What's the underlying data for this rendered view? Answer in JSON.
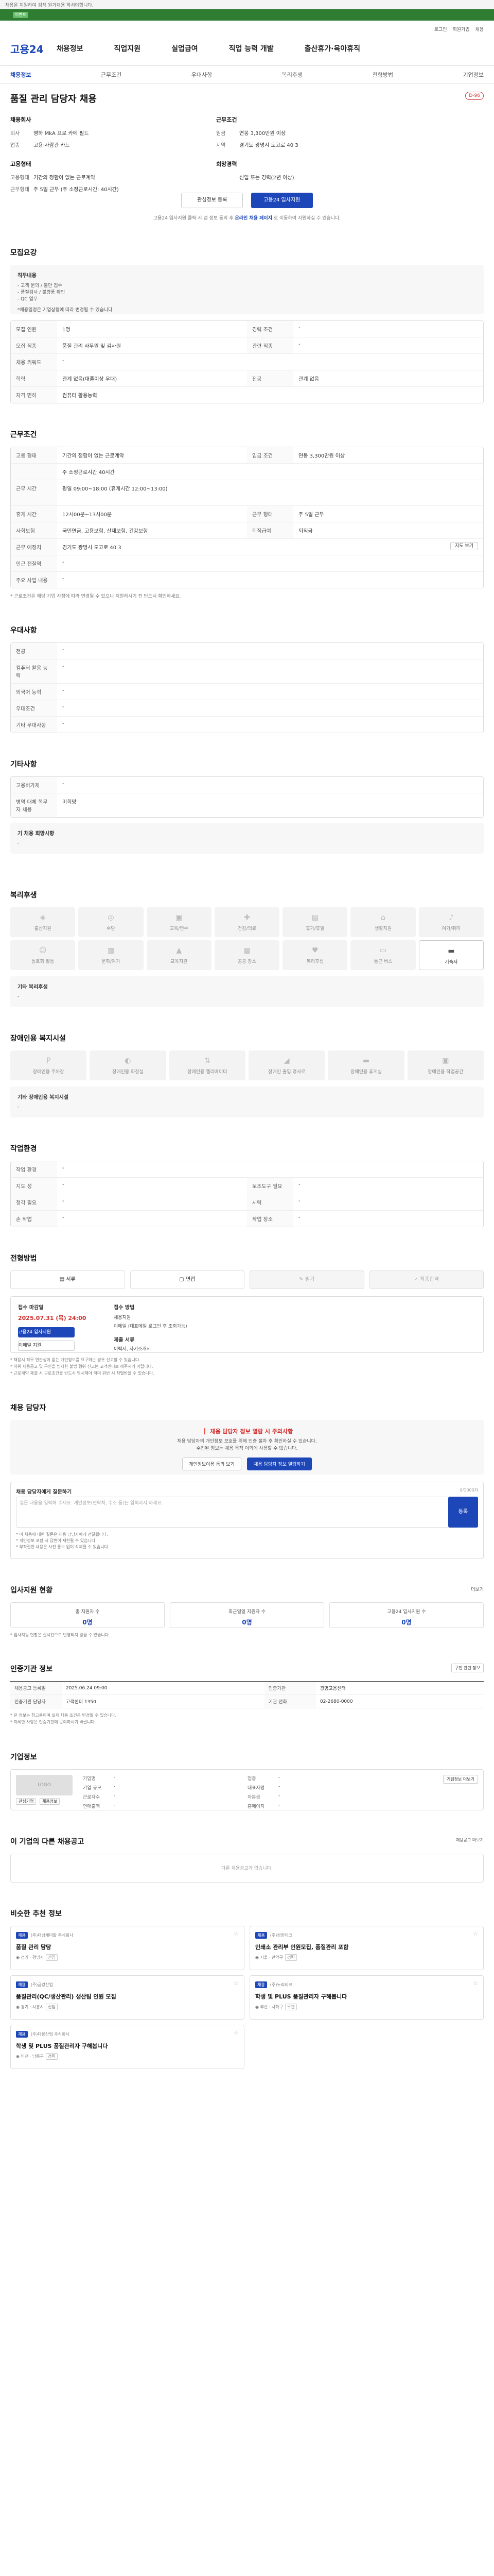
{
  "top": {
    "notice": "채용을 지원하여 검색 원가채용 하셔야합니다.",
    "promo_label": "이벤트"
  },
  "header": {
    "util": [
      "로그인",
      "회원가입",
      "채용"
    ],
    "logo": "고용24",
    "gnb": [
      "채용정보",
      "직업지원",
      "실업급여",
      "직업 능력 개발",
      "출산휴가·육아휴직"
    ]
  },
  "lnb": [
    "채용정보",
    "근무조건",
    "우대사항",
    "복리후생",
    "전형방법",
    "기업정보"
  ],
  "job": {
    "title": "품질 관리 담당자 채용",
    "dday": "D-96",
    "left_label": "채용회사",
    "left_rows": [
      {
        "k": "회사",
        "v": "영하 MkA 프로 카메 필드"
      },
      {
        "k": "업종",
        "v": "고용·사람관 카드"
      }
    ],
    "left2_label": "고용형태",
    "left2_rows": [
      {
        "k": "고용형태",
        "v": "기간의 정함이 없는 근로계약"
      },
      {
        "k": "근무형태",
        "v": "주 5일 근무 (주 소정근로시간: 40시간)"
      }
    ],
    "right_label": "근무조건",
    "right_rows": [
      {
        "k": "임금",
        "v": "연봉 3,300만원 이상"
      },
      {
        "k": "지역",
        "v": "경기도 광명시 도고로 40 3"
      }
    ],
    "right2_label": "희망경력",
    "right2_rows": [
      {
        "k": "",
        "v": "신입 또는 경력(2년 이상)"
      }
    ],
    "btn_save": "관심정보 등록",
    "btn_apply": "고용24 입사지원",
    "btn_note_a": "고용24 입사지원 클릭 시 앱 정보 동의 후",
    "btn_note_b": "온라인 채용 페이지",
    "btn_note_c": "로 이동하여 지원하실 수 있습니다."
  },
  "recruit": {
    "title": "모집요강",
    "intro_label": "직무내용",
    "intro_lines": [
      "- 고객 문의 / 불만 접수",
      "- 품질검사 / 불량품 확인",
      "- QC 업무",
      "",
      "*채용일정은 기업상황에 따라 변경될 수 있습니다"
    ],
    "rows": [
      [
        {
          "k": "모집 인원",
          "v": "1명"
        },
        {
          "k": "경력 조건",
          "v": "-"
        }
      ],
      [
        {
          "k": "모집 직종",
          "v": "품질 관리 사무원 및 검사원"
        },
        {
          "k": "관련 직종",
          "v": "-"
        }
      ],
      [
        {
          "k": "채용 키워드",
          "v": "-"
        },
        {
          "k": "",
          "v": ""
        }
      ],
      [
        {
          "k": "학력",
          "v": "관계 없음(대졸이상 우대)"
        },
        {
          "k": "전공",
          "v": "관계 없음"
        }
      ],
      [
        {
          "k": "자격 면허",
          "v": "컴퓨터 활용능력"
        },
        {
          "k": "",
          "v": ""
        }
      ]
    ]
  },
  "work": {
    "title": "근무조건",
    "rows": [
      [
        {
          "k": "고용 형태",
          "v": "기간의 정함이 없는 근로계약"
        },
        {
          "k": "임금 조건",
          "v": "연봉 3,300만원 이상"
        }
      ],
      [
        {
          "k": "",
          "v": "주 소정근로시간 40시간"
        },
        {
          "k": "",
          "v": ""
        }
      ],
      [
        {
          "k": "근무 시간",
          "v": "평일 09:00~18:00 (휴게시간 12:00~13:00)"
        },
        {
          "k": "",
          "v": ""
        }
      ],
      [
        {
          "k": "휴게 시간",
          "v": "12시00분~13시00분"
        },
        {
          "k": "근무 형태",
          "v": "주 5일 근무"
        }
      ],
      [
        {
          "k": "사회보험",
          "v": "국민연금, 고용보험, 산재보험, 건강보험"
        },
        {
          "k": "퇴직급여",
          "v": "퇴직금"
        }
      ],
      [
        {
          "k": "근무 예정지",
          "v": "경기도 광명시 도고로 40 3"
        },
        {
          "k": "",
          "v": ""
        }
      ],
      [
        {
          "k": "인근 전철역",
          "v": "-"
        },
        {
          "k": "",
          "v": ""
        }
      ],
      [
        {
          "k": "주요 사업 내용",
          "v": "-"
        },
        {
          "k": "",
          "v": ""
        }
      ]
    ],
    "map_btn": "지도 보기",
    "note": "* 근로조건은 해당 기업 사정에 따라 변경될 수 있으니 지원하시기 전 반드시 확인하세요."
  },
  "prefer": {
    "title": "우대사항",
    "rows": [
      {
        "k": "전공",
        "v": "-"
      },
      {
        "k": "컴퓨터 활용 능력",
        "v": "-"
      },
      {
        "k": "외국어 능력",
        "v": "-"
      },
      {
        "k": "우대조건",
        "v": "-"
      },
      {
        "k": "기타 우대사항",
        "v": "-"
      }
    ]
  },
  "etc": {
    "title": "기타사항",
    "rows": [
      {
        "k": "고용허가제",
        "v": "-"
      },
      {
        "k": "병역 대체 복무자 채용",
        "v": "미희망"
      }
    ],
    "more_label": "기 채용 희망사항",
    "more_val": "-"
  },
  "welfare": {
    "title": "복리후생",
    "items": [
      "출산지원",
      "수당",
      "교육/연수",
      "건강/의료",
      "휴가/휴일",
      "생활지원",
      "여가/취미",
      "동호회 활동",
      "문화/여가",
      "교육지원",
      "공공 장소",
      "복리후생",
      "통근 버스",
      "기숙사"
    ],
    "active_index": 13,
    "etc_label": "기타 복리후생",
    "etc_val": "-"
  },
  "disab": {
    "title": "장애인용 복지시설",
    "items": [
      "장애인용 주차장",
      "장애인용 화장실",
      "장애인용 엘리베이터",
      "장애인 출입 경사로",
      "장애인용 휴게실",
      "장애인용 작업공간"
    ],
    "etc_label": "기타 장애인용 복지시설",
    "etc_val": "-"
  },
  "env": {
    "title": "작업환경",
    "rows": [
      [
        {
          "k": "작업 환경",
          "v": "-"
        },
        {
          "k": "",
          "v": ""
        }
      ],
      [
        {
          "k": "지도 성",
          "v": "-"
        },
        {
          "k": "보조도구 필요",
          "v": "-"
        }
      ],
      [
        {
          "k": "청각 필요",
          "v": "-"
        },
        {
          "k": "시력",
          "v": "-"
        }
      ],
      [
        {
          "k": "손 작업",
          "v": "-"
        },
        {
          "k": "작업 장소",
          "v": "-"
        }
      ]
    ]
  },
  "process": {
    "title": "전형방법",
    "steps": [
      "서류",
      "면접",
      "필기",
      "최종합격"
    ],
    "apply_period_label": "접수 마감일",
    "apply_period": "2025.07.31 (목) 24:00",
    "method_label": "접수 방법",
    "method": "채용지원",
    "method_sub": "이메일 (대표메일 로그인 후 조회가능)",
    "docs_label": "제출 서류",
    "docs": "이력서, 자기소개서",
    "btn_apply": "고용24 입사지원",
    "btn_mail": "이메일 지원",
    "notes": [
      "* 채용시 직무 연관성이 없는 개인정보를 요구하는 경우 신고할 수 있습니다.",
      "* 허위 채용공고 및 구인을 빙자한 불법 행위 신고는 고객센터로 해주시기 바랍니다.",
      "* 근로계약 체결 시 근로조건을 반드시 명시해야 하며 위반 시 처벌받을 수 있습니다."
    ]
  },
  "manager": {
    "title": "채용 담당자",
    "warn": "채용 담당자 정보 열람 시 주의사항",
    "sub1": "채용 담당자의 개인정보 보호를 위해 인증 절차 후 확인하실 수 있습니다.",
    "sub2": "수집된 정보는 채용 목적 이외에 사용할 수 없습니다.",
    "btn1": "개인정보이용 동의 보기",
    "btn2": "채용 담당자 정보 열람하기"
  },
  "qna": {
    "title": "채용 담당자에게 질문하기",
    "count": "0/1000자",
    "placeholder": "질문 내용을 입력해 주세요. 개인정보(연락처, 주소 등)는 입력하지 마세요.",
    "btn": "등록",
    "notes": [
      "* 이 채용에 대한 질문은 채용 담당자에게 전달됩니다.",
      "* 개인정보 포함 시 답변이 제한될 수 있습니다.",
      "* 부적절한 내용은 사전 통보 없이 삭제될 수 있습니다."
    ]
  },
  "stats": {
    "title": "입사지원 현황",
    "more": "더보기",
    "items": [
      {
        "label": "총 지원자 수",
        "n": "0명"
      },
      {
        "label": "최근일일 지원자 수",
        "n": "0명"
      },
      {
        "label": "고용24 입사지원 수",
        "n": "0명"
      }
    ],
    "note": "* 입사지원 현황은 실시간으로 반영되지 않을 수 있습니다."
  },
  "info": {
    "title": "인증기관 정보",
    "btn": "구인 관련 정보",
    "rows": [
      [
        {
          "k": "채용공고 등록일",
          "v": "2025.06.24 09:00"
        },
        {
          "k": "인증기관",
          "v": "광명고용센터"
        }
      ],
      [
        {
          "k": "인증기관 담당자",
          "v": "고객센터 1350"
        },
        {
          "k": "기관 전화",
          "v": "02-2680-0000"
        }
      ]
    ],
    "notes": [
      "* 본 정보는 참고용이며 실제 채용 조건은 변경될 수 있습니다.",
      "* 자세한 사항은 인증기관에 문의하시기 바랍니다."
    ]
  },
  "corp": {
    "title": "기업정보",
    "logo": "LOGO",
    "rows": [
      [
        {
          "k": "기업명",
          "v": "-"
        },
        {
          "k": "업종",
          "v": "-"
        }
      ],
      [
        {
          "k": "기업 규모",
          "v": "-"
        },
        {
          "k": "대표자명",
          "v": "-"
        }
      ],
      [
        {
          "k": "근로자수",
          "v": "-"
        },
        {
          "k": "자본금",
          "v": "-"
        }
      ],
      [
        {
          "k": "연매출액",
          "v": "-"
        },
        {
          "k": "홈페이지",
          "v": "-"
        }
      ]
    ],
    "btn_corp": "기업정보 더보기",
    "btn_a": "관심기업",
    "btn_b": "채용정보"
  },
  "recom": {
    "title": "이 기업의 다른 채용공고",
    "empty": "다른 채용공고가 없습니다.",
    "more": "채용공고 더보기"
  },
  "related": {
    "title": "비슷한 추천 정보",
    "cards": [
      {
        "tag": "채용",
        "co": "(주)대성케미칼 주식회사",
        "title": "품질 관리 담당",
        "meta": "경기 · 광명시",
        "chip": "신입"
      },
      {
        "tag": "채용",
        "co": "(주)삼양테크",
        "title": "인쇄소 관리부 인원모집, 품질관리 포함",
        "meta": "서울 · 관악구",
        "chip": "경력"
      },
      {
        "tag": "채용",
        "co": "(주)금강산업",
        "title": "품질관리(QC/생산관리) 생산팀 인원 모집",
        "meta": "경기 · 시흥시",
        "chip": "신입"
      },
      {
        "tag": "채용",
        "co": "(주)누리테크",
        "title": "학생 및 PLUS 품질관리자 구해봅니다",
        "meta": "부산 · 사하구",
        "chip": "무관"
      },
      {
        "tag": "채용",
        "co": "(주)다온산업 주식회사",
        "title": "학생 및 PLUS 품질관리자 구해봅니다",
        "meta": "인천 · 남동구",
        "chip": "경력"
      }
    ]
  }
}
